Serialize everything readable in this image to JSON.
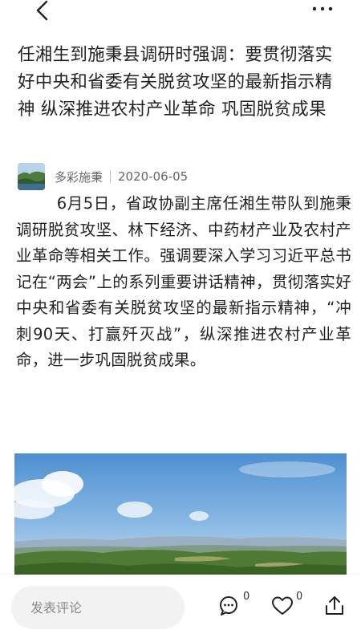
{
  "article": {
    "title": "任湘生到施秉县调研时强调：要贯彻落实好中央和省委有关脱贫攻坚的最新指示精神 纵深推进农村产业革命 巩固脱贫成果",
    "author": "多彩施秉",
    "date": "2020-06-05",
    "body": "6月5日，省政协副主席任湘生带队到施秉调研脱贫攻坚、林下经济、中药材产业及农村产业革命等相关工作。强调要深入学习习近平总书记在“两会”上的系列重要讲话精神，贯彻落实好中央和省委有关脱贫攻坚的最新指示精神，“冲刺90天、打赢歼灭战”，纵深推进农村产业革命，进一步巩固脱贫成果。"
  },
  "icons": {
    "back": "back-arrow-icon",
    "more": "more-dots-icon",
    "comment": "comment-bubble-icon",
    "like": "heart-icon",
    "share": "share-icon"
  },
  "bottom_bar": {
    "comment_placeholder": "发表评论",
    "comment_count": "0",
    "like_count": "0"
  },
  "colors": {
    "text": "#222222",
    "meta": "#666666",
    "input_bg": "#f2f2f2"
  }
}
